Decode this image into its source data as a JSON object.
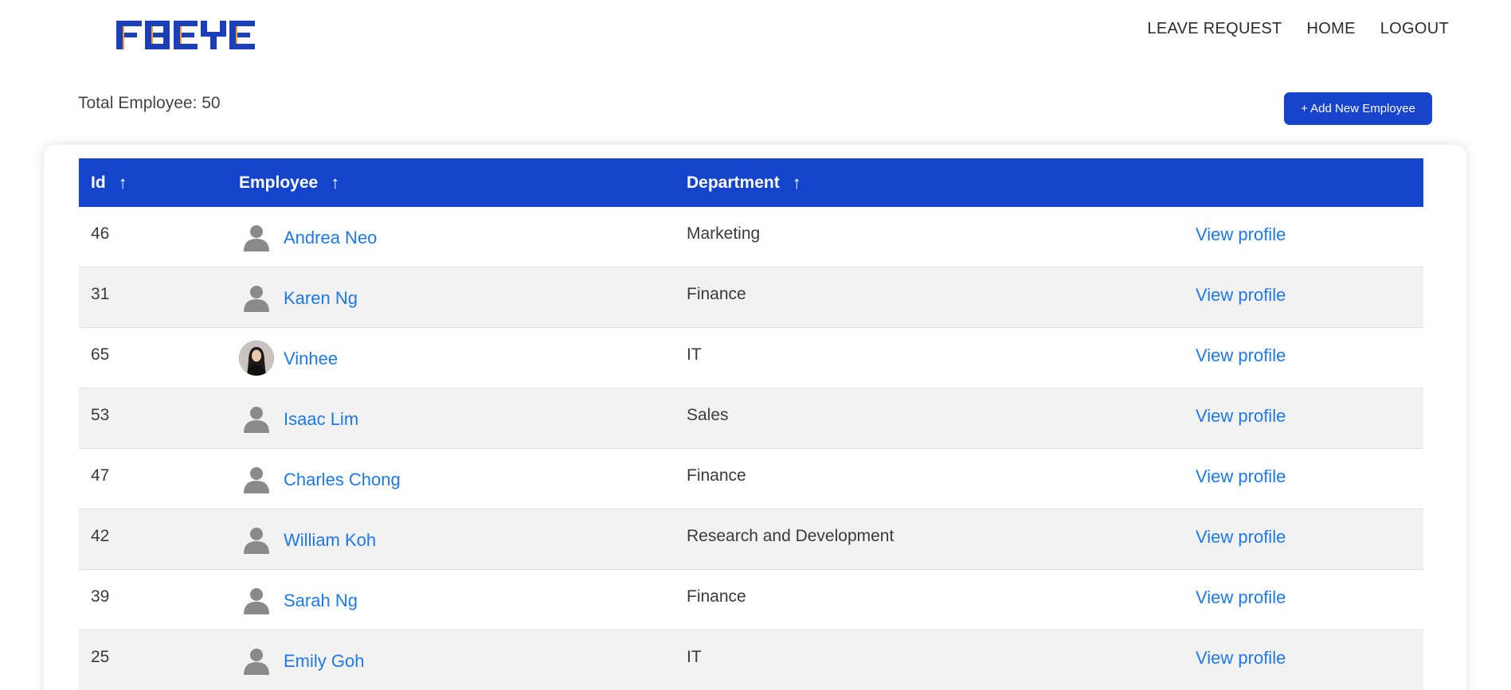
{
  "header": {
    "logo_text": "FBEYE",
    "nav": [
      "LEAVE REQUEST",
      "HOME",
      "LOGOUT"
    ]
  },
  "summary": {
    "total_label": "Total Employee: 50"
  },
  "actions": {
    "add_label": "+ Add New Employee"
  },
  "table": {
    "columns": [
      "Id",
      "Employee",
      "Department"
    ],
    "sort_glyph": "↑",
    "view_label": "View profile",
    "rows": [
      {
        "id": "46",
        "name": "Andrea Neo",
        "department": "Marketing",
        "avatar": "generic"
      },
      {
        "id": "31",
        "name": "Karen Ng",
        "department": "Finance",
        "avatar": "generic"
      },
      {
        "id": "65",
        "name": "Vinhee",
        "department": "IT",
        "avatar": "photo"
      },
      {
        "id": "53",
        "name": "Isaac Lim",
        "department": "Sales",
        "avatar": "generic"
      },
      {
        "id": "47",
        "name": "Charles Chong",
        "department": "Finance",
        "avatar": "generic"
      },
      {
        "id": "42",
        "name": "William Koh",
        "department": "Research and Development",
        "avatar": "generic"
      },
      {
        "id": "39",
        "name": "Sarah Ng",
        "department": "Finance",
        "avatar": "generic"
      },
      {
        "id": "25",
        "name": "Emily Goh",
        "department": "IT",
        "avatar": "generic"
      }
    ]
  },
  "colors": {
    "primary": "#1443cc",
    "link": "#1e78e6",
    "logo_orange": "#f0a030"
  }
}
